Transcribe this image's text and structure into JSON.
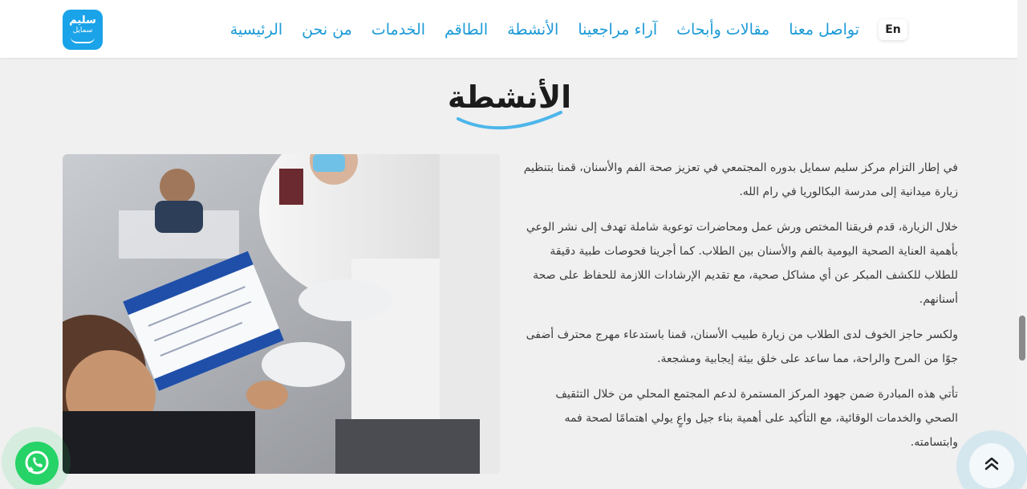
{
  "brand": {
    "line1": "سليم",
    "line2": "سمايل"
  },
  "nav": {
    "items": [
      "الرئيسية",
      "من نحن",
      "الخدمات",
      "الطاقم",
      "الأنشطة",
      "آراء مراجعينا",
      "مقالات وأبحاث",
      "تواصل معنا"
    ],
    "lang": "En"
  },
  "page": {
    "title": "الأنشطة"
  },
  "article": {
    "paragraphs": [
      "في إطار التزام مركز سليم سمايل بدوره المجتمعي في تعزيز صحة الفم والأسنان، قمنا بتنظيم زيارة ميدانية إلى مدرسة البكالوريا في رام الله.",
      "خلال الزيارة، قدم فريقنا المختص ورش عمل ومحاضرات توعوية شاملة تهدف إلى نشر الوعي بأهمية العناية الصحية اليومية بالفم والأسنان بين الطلاب. كما أجرينا فحوصات طبية دقيقة للطلاب للكشف المبكر عن أي مشاكل صحية، مع تقديم الإرشادات اللازمة للحفاظ على صحة أسنانهم.",
      "ولكسر حاجز الخوف لدى الطلاب من زيارة طبيب الأسنان، قمنا باستدعاء مهرج محترف أضفى جوًا من المرح والراحة، مما ساعد على خلق بيئة إيجابية ومشجعة.",
      "تأتي هذه المبادرة ضمن جهود المركز المستمرة لدعم المجتمع المحلي من خلال التثقيف الصحي والخدمات الوقائية، مع التأكيد على أهمية بناء جيل واعٍ يولي اهتمامًا لصحة فمه وابتسامته."
    ]
  },
  "icons": {
    "whatsapp": "whatsapp-icon",
    "back_to_top": "double-chevron-up-icon"
  },
  "colors": {
    "accent": "#1b9ad6",
    "logo_bg": "#1aa3e8",
    "whatsapp": "#25d366"
  }
}
